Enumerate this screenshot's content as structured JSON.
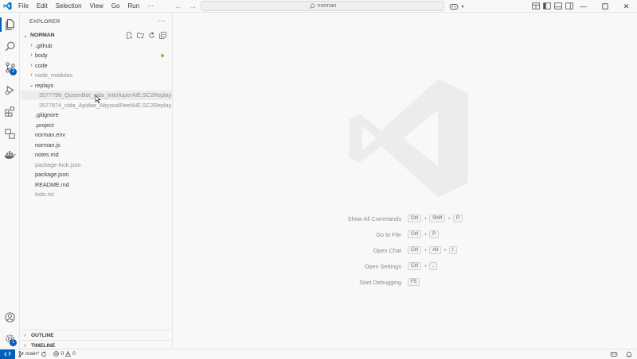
{
  "titlebar": {
    "menus": [
      "File",
      "Edit",
      "Selection",
      "View",
      "Go",
      "Run",
      "···"
    ],
    "search_text": "norman",
    "icons": [
      "vscode-logo-icon",
      "back-arrow-icon",
      "forward-arrow-icon",
      "search-icon",
      "copilot-icon",
      "layout-icons",
      "minimize-icon",
      "maximize-icon",
      "close-icon"
    ]
  },
  "activitybar": {
    "items": [
      {
        "name": "explorer-icon",
        "badge": ""
      },
      {
        "name": "search-icon",
        "badge": ""
      },
      {
        "name": "source-control-icon",
        "badge": "2"
      },
      {
        "name": "run-debug-icon",
        "badge": ""
      },
      {
        "name": "extensions-icon",
        "badge": ""
      },
      {
        "name": "remote-explorer-icon",
        "badge": ""
      },
      {
        "name": "docker-icon",
        "badge": ""
      }
    ],
    "accounts_icon": "account-icon",
    "manage_badge": "1"
  },
  "sidebar": {
    "title": "EXPLORER",
    "root": "NORMAN",
    "tree": [
      {
        "label": ".github",
        "type": "folder",
        "expanded": false,
        "dim": false
      },
      {
        "label": "body",
        "type": "folder",
        "expanded": false,
        "dim": false,
        "modified_dot": true
      },
      {
        "label": "code",
        "type": "folder",
        "expanded": false,
        "dim": false
      },
      {
        "label": "node_modules",
        "type": "folder",
        "expanded": false,
        "dim": true
      },
      {
        "label": "replays",
        "type": "folder",
        "expanded": true,
        "dim": false
      },
      {
        "label": "3577798_QueenBot_nida_InterloperAIE.SC2Replay",
        "type": "file",
        "level": 2,
        "dim": true
      },
      {
        "label": "3577874_nida_Apidae_AbyssalReefAIE.SC2Replay",
        "type": "file",
        "level": 2,
        "dim": true
      },
      {
        "label": ".gitignore",
        "type": "file",
        "dim": false
      },
      {
        "label": ".project",
        "type": "file",
        "dim": false
      },
      {
        "label": "norman.env",
        "type": "file",
        "dim": false
      },
      {
        "label": "norman.js",
        "type": "file",
        "dim": false
      },
      {
        "label": "notes.md",
        "type": "file",
        "dim": false
      },
      {
        "label": "package-lock.json",
        "type": "file",
        "dim": true
      },
      {
        "label": "package.json",
        "type": "file",
        "dim": false
      },
      {
        "label": "README.md",
        "type": "file",
        "dim": false
      },
      {
        "label": "todo.txt",
        "type": "file",
        "dim": true
      }
    ],
    "outline": "OUTLINE",
    "timeline": "TIMELINE"
  },
  "editor": {
    "shortcuts": [
      {
        "label": "Show All Commands",
        "keys": [
          "Ctrl",
          "Shift",
          "P"
        ]
      },
      {
        "label": "Go to File",
        "keys": [
          "Ctrl",
          "P"
        ]
      },
      {
        "label": "Open Chat",
        "keys": [
          "Ctrl",
          "Alt",
          "I"
        ]
      },
      {
        "label": "Open Settings",
        "keys": [
          "Ctrl",
          ","
        ]
      },
      {
        "label": "Start Debugging",
        "keys": [
          "F5"
        ]
      }
    ]
  },
  "statusbar": {
    "branch": "main*",
    "errors": "0",
    "warnings": "0"
  },
  "colors": {
    "accent": "#005fb8",
    "background": "#f8f8f8",
    "border": "#e5e5e5",
    "modified_dot": "#b89a5b"
  }
}
